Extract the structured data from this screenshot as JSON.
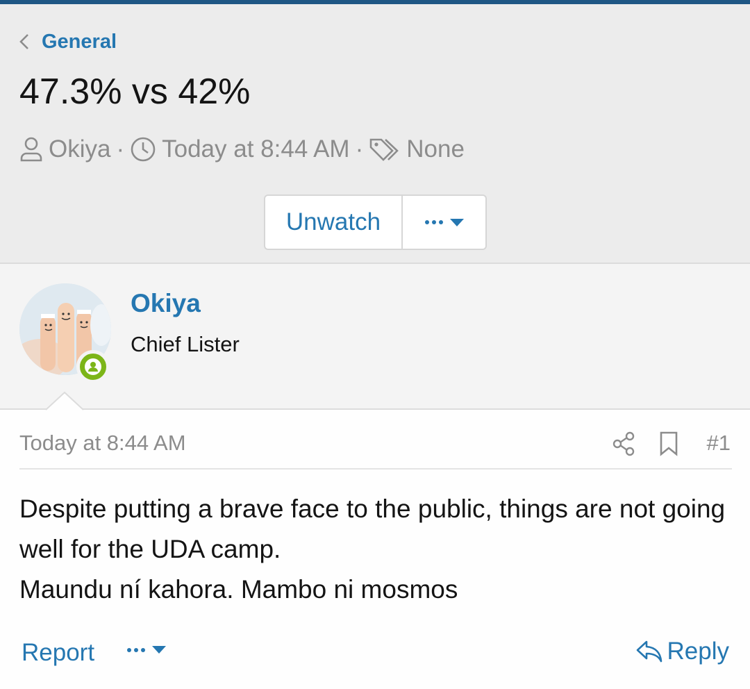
{
  "breadcrumb": {
    "label": "General",
    "icon": "chevron-left-icon"
  },
  "thread": {
    "title": "47.3% vs 42%",
    "author": "Okiya",
    "time": "Today at 8:44 AM",
    "tags": "None",
    "separator": "·"
  },
  "actions": {
    "unwatch_label": "Unwatch",
    "more_icon": "ellipsis-icon"
  },
  "user": {
    "name": "Okiya",
    "title": "Chief Lister",
    "status": "online"
  },
  "post": {
    "date": "Today at 8:44 AM",
    "number": "#1",
    "lines": [
      "Despite putting a brave face to the public, things are not going well for the UDA camp.",
      "Maundu ní kahora. Mambo ni mosmos"
    ]
  },
  "footer": {
    "report_label": "Report",
    "reply_label": "Reply"
  },
  "colors": {
    "accent": "#2577b1",
    "online": "#7cb518",
    "topbar": "#1f5785",
    "muted": "#8c8c8c"
  }
}
